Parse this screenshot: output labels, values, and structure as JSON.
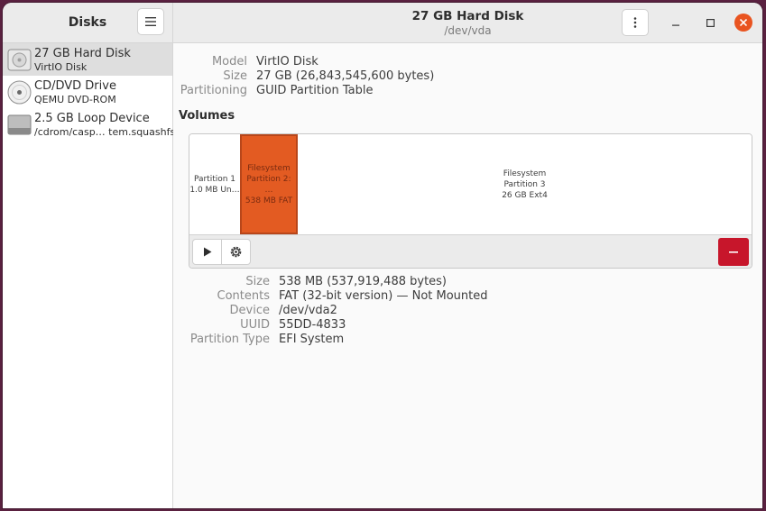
{
  "sidebar": {
    "title": "Disks",
    "items": [
      {
        "name": "27 GB Hard Disk",
        "sub": "VirtIO Disk",
        "selected": true
      },
      {
        "name": "CD/DVD Drive",
        "sub": "QEMU DVD-ROM",
        "selected": false
      },
      {
        "name": "2.5 GB Loop Device",
        "sub": "/cdrom/casp…  tem.squashfs",
        "selected": false
      }
    ]
  },
  "header": {
    "title": "27 GB Hard Disk",
    "subtitle": "/dev/vda",
    "menu_icon": "hamburger-icon",
    "kebab_icon": "kebab-icon"
  },
  "disk_info": {
    "model_label": "Model",
    "model_value": "VirtIO Disk",
    "size_label": "Size",
    "size_value": "27 GB (26,843,545,600 bytes)",
    "partitioning_label": "Partitioning",
    "partitioning_value": "GUID Partition Table"
  },
  "volumes": {
    "title": "Volumes",
    "partitions": [
      {
        "line1": "",
        "line2": "Partition 1",
        "line3": "1.0 MB Un…"
      },
      {
        "line1": "Filesystem",
        "line2": "Partition 2: …",
        "line3": "538 MB FAT"
      },
      {
        "line1": "Filesystem",
        "line2": "Partition 3",
        "line3": "26 GB Ext4"
      }
    ],
    "selected_color": "#e35b22"
  },
  "partition_info": {
    "size_label": "Size",
    "size_value": "538 MB (537,919,488 bytes)",
    "contents_label": "Contents",
    "contents_value": "FAT (32-bit version) — Not Mounted",
    "device_label": "Device",
    "device_value": "/dev/vda2",
    "uuid_label": "UUID",
    "uuid_value": "55DD-4833",
    "type_label": "Partition Type",
    "type_value": "EFI System"
  },
  "colors": {
    "accent": "#e95420",
    "danger": "#c7162b"
  }
}
